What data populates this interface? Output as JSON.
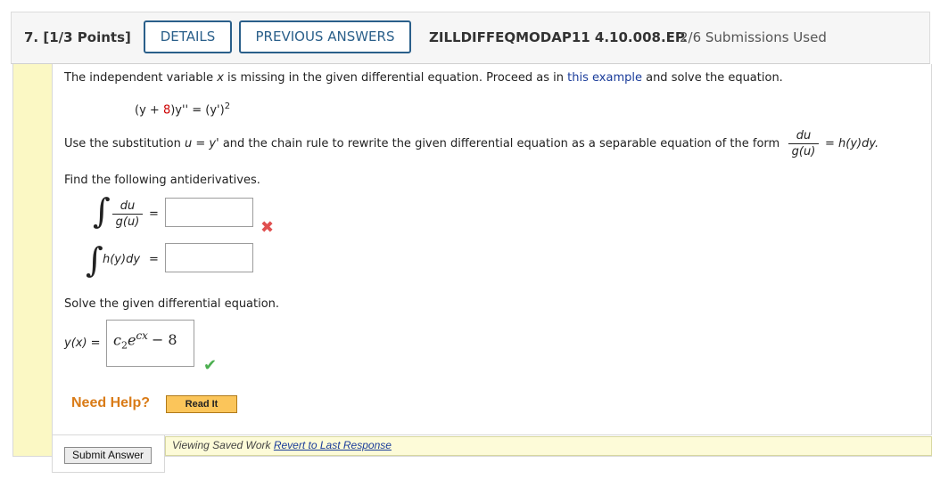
{
  "header": {
    "question_number": "7. [1/3 Points]",
    "details_button": "DETAILS",
    "previous_answers_button": "PREVIOUS ANSWERS",
    "question_id": "ZILLDIFFEQMODAP11 4.10.008.EP.",
    "submissions": "2/6 Submissions Used"
  },
  "problem": {
    "intro_pre": "The independent variable ",
    "intro_var": "x",
    "intro_mid": " is missing in the given differential equation. Proceed as in ",
    "intro_link": "this example",
    "intro_post": " and solve the equation.",
    "eq_open": "(y + ",
    "eq_const": "8",
    "eq_rest": ")y'' = (y')",
    "eq_exp": "2",
    "sub_pre": "Use the substitution ",
    "sub_u": "u = y'",
    "sub_mid": " and the chain rule to rewrite the given differential equation as a separable equation of the form ",
    "frac_num": "du",
    "frac_den": "g(u)",
    "sub_post": "= h(y)dy.",
    "antideriv_prompt": "Find the following antiderivatives.",
    "int1_num": "du",
    "int1_den": "g(u)",
    "int1_eq": "=",
    "int2_expr": "h(y)dy",
    "int2_eq": "=",
    "solve_prompt": "Solve the given differential equation.",
    "y_label": "y(x) =",
    "answer_coef": "c",
    "answer_sub": "2",
    "answer_e": "e",
    "answer_exp": "cx",
    "answer_tail": "− 8"
  },
  "help": {
    "need_help": "Need Help?",
    "read_it": "Read It"
  },
  "footer": {
    "submit": "Submit Answer",
    "saved_text": "Viewing Saved Work ",
    "revert_link": "Revert to Last Response"
  },
  "colors": {
    "accent": "#2a5f8a",
    "error": "#e05050",
    "success": "#4caf50",
    "help": "#d97b17",
    "highlight": "#fbf8c4"
  },
  "icons": {
    "incorrect": "x-mark-icon",
    "correct": "check-mark-icon"
  }
}
